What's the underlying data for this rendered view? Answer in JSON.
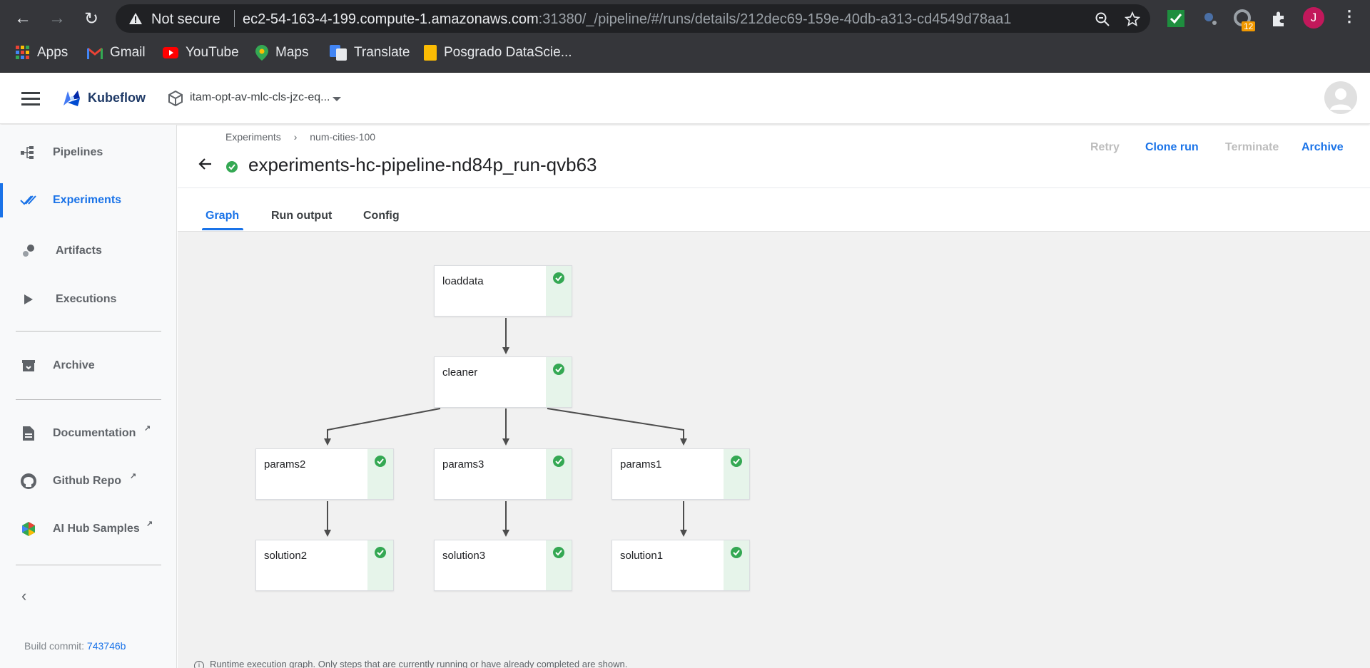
{
  "browser": {
    "security_label": "Not secure",
    "url_host": "ec2-54-163-4-199.compute-1.amazonaws.com",
    "url_rest": ":31380/_/pipeline/#/runs/details/212dec69-159e-40db-a313-cd4549d78aa1",
    "extension_badge": "12",
    "profile_initial": "J",
    "bookmarks": [
      "Apps",
      "Gmail",
      "YouTube",
      "Maps",
      "Translate",
      "Posgrado DataScie..."
    ]
  },
  "app": {
    "brand": "Kubeflow",
    "namespace": "itam-opt-av-mlc-cls-jzc-eq..."
  },
  "sidebar": {
    "items": [
      {
        "label": "Pipelines",
        "icon": "pipelines-icon"
      },
      {
        "label": "Experiments",
        "icon": "experiments-icon"
      },
      {
        "label": "Artifacts",
        "icon": "artifacts-icon"
      },
      {
        "label": "Executions",
        "icon": "executions-icon"
      },
      {
        "label": "Archive",
        "icon": "archive-icon"
      },
      {
        "label": "Documentation",
        "icon": "documentation-icon"
      },
      {
        "label": "Github Repo",
        "icon": "github-icon"
      },
      {
        "label": "AI Hub Samples",
        "icon": "ai-hub-icon"
      }
    ],
    "build_label": "Build commit:",
    "build_commit": "743746b"
  },
  "breadcrumbs": [
    "Experiments",
    "num-cities-100"
  ],
  "run": {
    "title": "experiments-hc-pipeline-nd84p_run-qvb63",
    "status": "succeeded"
  },
  "actions": {
    "retry": "Retry",
    "clone": "Clone run",
    "terminate": "Terminate",
    "archive": "Archive"
  },
  "tabs": [
    "Graph",
    "Run output",
    "Config"
  ],
  "graph": {
    "nodes": [
      "loaddata",
      "cleaner",
      "params2",
      "params3",
      "params1",
      "solution2",
      "solution3",
      "solution1"
    ],
    "footnote": "Runtime execution graph. Only steps that are currently running or have already completed are shown."
  },
  "colors": {
    "accent": "#1a73e8",
    "success": "#34a853",
    "success_bg": "#e6f4ea",
    "chrome": "#35363a"
  }
}
